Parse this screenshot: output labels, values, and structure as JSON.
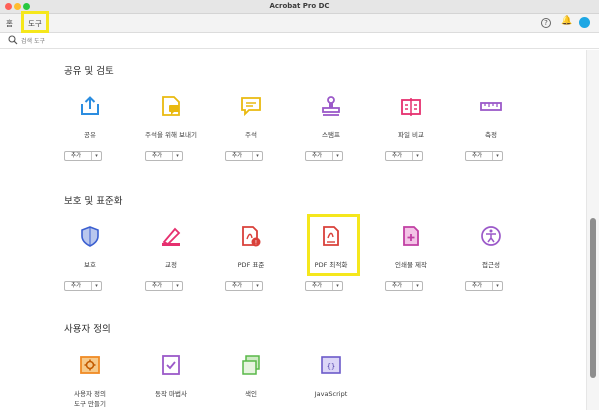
{
  "window": {
    "title": "Acrobat Pro DC"
  },
  "tabs": [
    {
      "label": "홈"
    },
    {
      "label": "도구"
    }
  ],
  "search": {
    "placeholder": "검색 도구"
  },
  "header_icons": {
    "help": "?",
    "bell": "🔔"
  },
  "sections": [
    {
      "title": "공유 및 검토",
      "tools": [
        {
          "label": "공유",
          "icon": "share-icon",
          "button": "추가"
        },
        {
          "label": "주석을 위해 보내기",
          "icon": "send-for-comments-icon",
          "button": "추가"
        },
        {
          "label": "주석",
          "icon": "comment-icon",
          "button": "추가"
        },
        {
          "label": "스탬프",
          "icon": "stamp-icon",
          "button": "추가"
        },
        {
          "label": "파일 비교",
          "icon": "compare-files-icon",
          "button": "추가"
        },
        {
          "label": "측정",
          "icon": "measure-icon",
          "button": "추가"
        }
      ]
    },
    {
      "title": "보호 및 표준화",
      "tools": [
        {
          "label": "보호",
          "icon": "protect-icon",
          "button": "추가"
        },
        {
          "label": "교정",
          "icon": "redact-icon",
          "button": "추가"
        },
        {
          "label": "PDF 표준",
          "icon": "pdf-standards-icon",
          "button": "추가"
        },
        {
          "label": "PDF 최적화",
          "icon": "optimize-pdf-icon",
          "button": "추가"
        },
        {
          "label": "인쇄물 제작",
          "icon": "print-production-icon",
          "button": "추가"
        },
        {
          "label": "접근성",
          "icon": "accessibility-icon",
          "button": "추가"
        }
      ]
    },
    {
      "title": "사용자 정의",
      "tools": [
        {
          "label": "사용자 정의\n도구 만들기",
          "icon": "create-custom-tool-icon"
        },
        {
          "label": "동작 마법사",
          "icon": "action-wizard-icon"
        },
        {
          "label": "색인",
          "icon": "index-icon"
        },
        {
          "label": "JavaScript",
          "icon": "javascript-icon"
        }
      ]
    }
  ],
  "colors": {
    "blue": "#2b8de0",
    "yellow": "#e9b90f",
    "purple": "#9b59c9",
    "pink": "#e6306f",
    "red": "#d9403a",
    "green": "#58b848",
    "orange": "#f08a24",
    "highlight": "#f5e71c"
  }
}
